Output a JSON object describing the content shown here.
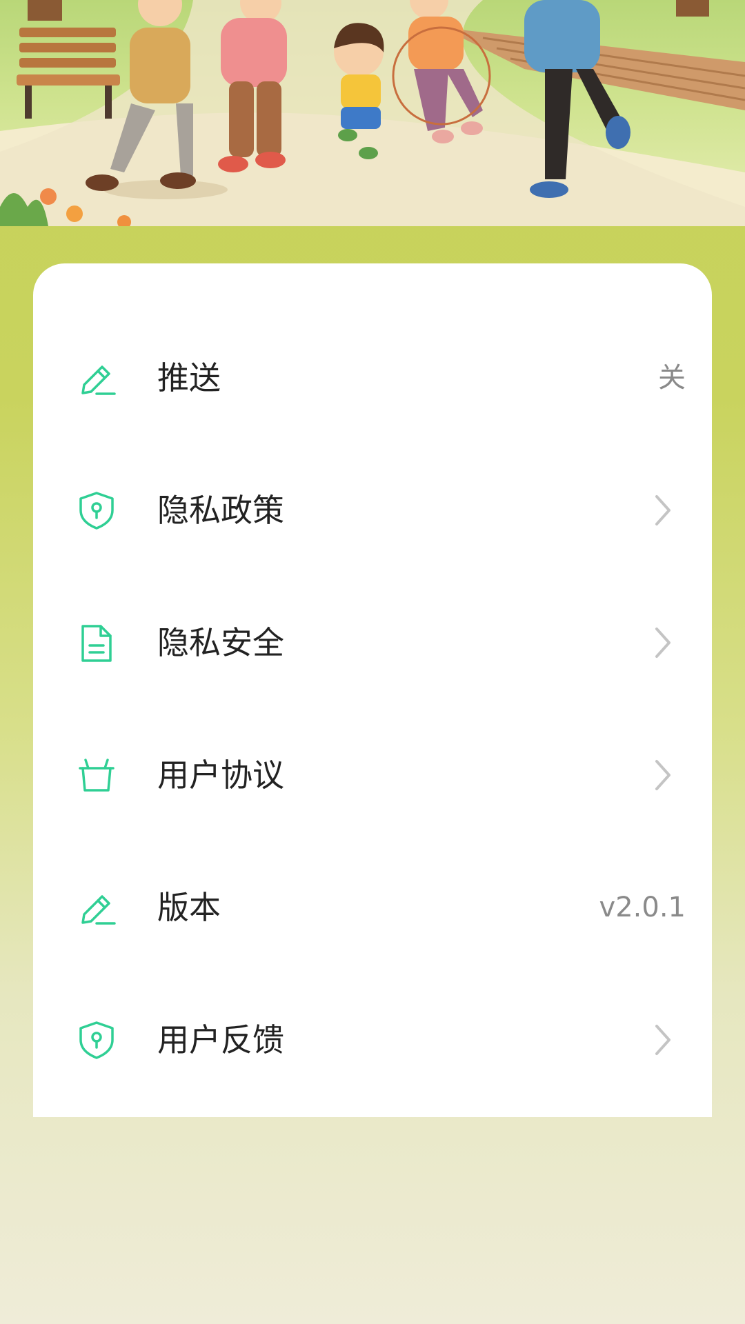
{
  "banner": {
    "icon": "family-exercise-illustration"
  },
  "colors": {
    "accent": "#2fcf94",
    "background_top": "#c6d25a",
    "background_bottom": "#efecd8",
    "label_text": "#222222",
    "value_text": "#8a8a8a"
  },
  "settings": {
    "items": [
      {
        "label": "推送",
        "value": "关",
        "icon": "pencil-edit-icon",
        "has_chevron": false
      },
      {
        "label": "隐私政策",
        "value": "",
        "icon": "shield-keyhole-icon",
        "has_chevron": true
      },
      {
        "label": "隐私安全",
        "value": "",
        "icon": "document-icon",
        "has_chevron": true
      },
      {
        "label": "用户协议",
        "value": "",
        "icon": "basket-icon",
        "has_chevron": true
      },
      {
        "label": "版本",
        "value": "v2.0.1",
        "icon": "pencil-edit-icon",
        "has_chevron": false
      },
      {
        "label": "用户反馈",
        "value": "",
        "icon": "shield-keyhole-icon",
        "has_chevron": true
      }
    ]
  }
}
